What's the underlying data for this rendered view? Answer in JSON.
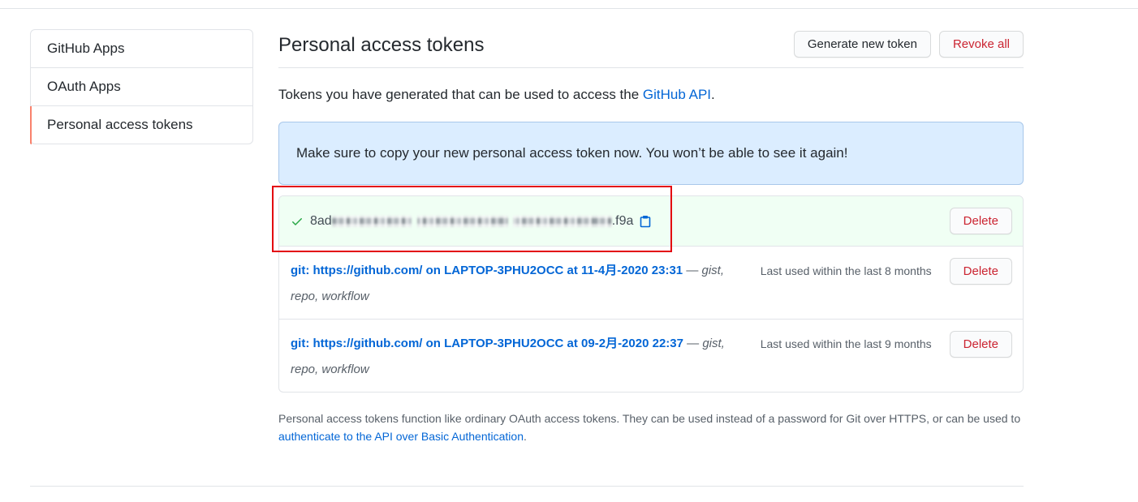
{
  "sidebar": {
    "items": [
      {
        "label": "GitHub Apps",
        "selected": false
      },
      {
        "label": "OAuth Apps",
        "selected": false
      },
      {
        "label": "Personal access tokens",
        "selected": true
      }
    ]
  },
  "header": {
    "title": "Personal access tokens",
    "generate_label": "Generate new token",
    "revoke_label": "Revoke all"
  },
  "intro": {
    "text_before": "Tokens you have generated that can be used to access the ",
    "link_text": "GitHub API",
    "text_after": "."
  },
  "flash": {
    "message": "Make sure to copy your new personal access token now. You won’t be able to see it again!"
  },
  "new_token": {
    "prefix": "8ad",
    "suffix": ".f9a",
    "delete_label": "Delete"
  },
  "tokens": [
    {
      "name": "git: https://github.com/ on LAPTOP-3PHU2OCC at 11-4月-2020 23:31",
      "separator": "—",
      "scopes": "gist, repo, workflow",
      "last_used": "Last used within the last 8 months",
      "delete_label": "Delete"
    },
    {
      "name": "git: https://github.com/ on LAPTOP-3PHU2OCC at 09-2月-2020 22:37",
      "separator": "—",
      "scopes": "gist, repo, workflow",
      "last_used": "Last used within the last 9 months",
      "delete_label": "Delete"
    }
  ],
  "footer": {
    "text_before": "Personal access tokens function like ordinary OAuth access tokens. They can be used instead of a password for Git over HTTPS, or can be used to ",
    "link_text": "authenticate to the API over Basic Authentication",
    "text_after": "."
  },
  "icons": {
    "check": "check-icon",
    "clipboard": "clipboard-icon"
  },
  "colors": {
    "text": "#24292e",
    "muted": "#586069",
    "link": "#0366d6",
    "border": "#e1e4e8",
    "danger": "#cb2431",
    "success": "#28a745",
    "selected_indicator": "#f9826c",
    "flash_bg": "#dbedff",
    "flash_border": "#a8c7ea",
    "new_token_bg": "#f0fff4",
    "annotation": "#e3000f",
    "token_text": "#444d56"
  }
}
